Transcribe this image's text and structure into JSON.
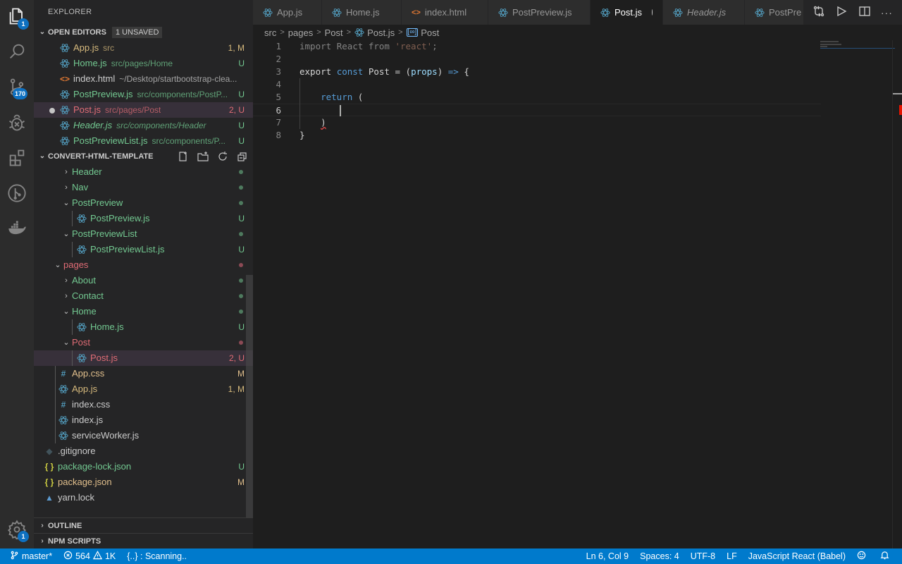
{
  "activity_bar": {
    "explorer_badge": "1",
    "scm_badge": "170",
    "settings_badge": "1"
  },
  "sidebar": {
    "title": "EXPLORER",
    "open_editors": {
      "label": "OPEN EDITORS",
      "badge": "1 UNSAVED",
      "items": [
        {
          "name": "App.js",
          "desc": "src",
          "status": "1, M",
          "color": "yellow",
          "icon": "react-icon"
        },
        {
          "name": "Home.js",
          "desc": "src/pages/Home",
          "status": "U",
          "color": "green",
          "icon": "react-icon"
        },
        {
          "name": "index.html",
          "desc": "~/Desktop/startbootstrap-clea...",
          "status": "",
          "color": "plain",
          "icon": "html-icon"
        },
        {
          "name": "PostPreview.js",
          "desc": "src/components/PostP...",
          "status": "U",
          "color": "green",
          "icon": "react-icon"
        },
        {
          "name": "Post.js",
          "desc": "src/pages/Post",
          "status": "2, U",
          "color": "red",
          "icon": "react-icon",
          "dirty": true
        },
        {
          "name": "Header.js",
          "desc": "src/components/Header",
          "status": "U",
          "color": "green",
          "icon": "react-icon",
          "italic": true
        },
        {
          "name": "PostPreviewList.js",
          "desc": "src/components/P...",
          "status": "U",
          "color": "green",
          "icon": "react-icon"
        }
      ]
    },
    "project": {
      "label": "CONVERT-HTML-TEMPLATE",
      "actions": [
        "new-file",
        "new-folder",
        "refresh",
        "collapse-all"
      ],
      "tree": [
        {
          "name": "Header",
          "type": "folder",
          "expanded": false,
          "depth": 2,
          "color": "green",
          "dot": "#4e7a5e"
        },
        {
          "name": "Nav",
          "type": "folder",
          "expanded": false,
          "depth": 2,
          "color": "green",
          "dot": "#4e7a5e"
        },
        {
          "name": "PostPreview",
          "type": "folder",
          "expanded": true,
          "depth": 2,
          "color": "green",
          "dot": "#4e7a5e"
        },
        {
          "name": "PostPreview.js",
          "type": "file",
          "depth": 3,
          "color": "green",
          "status": "U",
          "icon": "react-icon"
        },
        {
          "name": "PostPreviewList",
          "type": "folder",
          "expanded": true,
          "depth": 2,
          "color": "green",
          "dot": "#4e7a5e"
        },
        {
          "name": "PostPreviewList.js",
          "type": "file",
          "depth": 3,
          "color": "green",
          "status": "U",
          "icon": "react-icon"
        },
        {
          "name": "pages",
          "type": "folder",
          "expanded": true,
          "depth": 1,
          "color": "red",
          "dot": "#8c4a55"
        },
        {
          "name": "About",
          "type": "folder",
          "expanded": false,
          "depth": 2,
          "color": "green",
          "dot": "#4e7a5e"
        },
        {
          "name": "Contact",
          "type": "folder",
          "expanded": false,
          "depth": 2,
          "color": "green",
          "dot": "#4e7a5e"
        },
        {
          "name": "Home",
          "type": "folder",
          "expanded": true,
          "depth": 2,
          "color": "green",
          "dot": "#4e7a5e"
        },
        {
          "name": "Home.js",
          "type": "file",
          "depth": 3,
          "color": "green",
          "status": "U",
          "icon": "react-icon"
        },
        {
          "name": "Post",
          "type": "folder",
          "expanded": true,
          "depth": 2,
          "color": "red",
          "dot": "#8c4a55"
        },
        {
          "name": "Post.js",
          "type": "file",
          "depth": 3,
          "color": "red",
          "status": "2, U",
          "icon": "react-icon",
          "selected": true
        },
        {
          "name": "App.css",
          "type": "file",
          "depth": 1,
          "color": "mod",
          "status": "M",
          "icon": "css-icon"
        },
        {
          "name": "App.js",
          "type": "file",
          "depth": 1,
          "color": "yellow",
          "status": "1, M",
          "icon": "react-icon"
        },
        {
          "name": "index.css",
          "type": "file",
          "depth": 1,
          "color": "plain",
          "status": "",
          "icon": "css-icon"
        },
        {
          "name": "index.js",
          "type": "file",
          "depth": 1,
          "color": "plain",
          "status": "",
          "icon": "react-icon"
        },
        {
          "name": "serviceWorker.js",
          "type": "file",
          "depth": 1,
          "color": "plain",
          "status": "",
          "icon": "react-icon"
        },
        {
          "name": ".gitignore",
          "type": "file",
          "depth": 0,
          "color": "plain",
          "status": "",
          "icon": "git-icon"
        },
        {
          "name": "package-lock.json",
          "type": "file",
          "depth": 0,
          "color": "green",
          "status": "U",
          "icon": "json-icon"
        },
        {
          "name": "package.json",
          "type": "file",
          "depth": 0,
          "color": "mod",
          "status": "M",
          "icon": "json-icon"
        },
        {
          "name": "yarn.lock",
          "type": "file",
          "depth": 0,
          "color": "plain",
          "status": "",
          "icon": "yarn-icon"
        }
      ]
    },
    "outline_label": "OUTLINE",
    "npm_label": "NPM SCRIPTS"
  },
  "tabs": [
    {
      "label": "App.js",
      "icon": "react-icon"
    },
    {
      "label": "Home.js",
      "icon": "react-icon"
    },
    {
      "label": "index.html",
      "icon": "html-icon"
    },
    {
      "label": "PostPreview.js",
      "icon": "react-icon"
    },
    {
      "label": "Post.js",
      "icon": "react-icon",
      "active": true,
      "dirty": true
    },
    {
      "label": "Header.js",
      "icon": "react-icon",
      "italic": true
    },
    {
      "label": "PostPre",
      "icon": "react-icon"
    }
  ],
  "breadcrumb": [
    "src",
    "pages",
    "Post",
    "Post.js",
    "Post"
  ],
  "editor": {
    "lines": [
      {
        "n": "1",
        "tokens": [
          [
            "dim",
            "import "
          ],
          [
            "dim",
            "React "
          ],
          [
            "dim",
            "from "
          ],
          [
            "str",
            "'react'"
          ],
          [
            "dim",
            ";"
          ]
        ]
      },
      {
        "n": "2",
        "tokens": []
      },
      {
        "n": "3",
        "tokens": [
          [
            "id",
            "export "
          ],
          [
            "kw2",
            "const "
          ],
          [
            "id",
            "Post "
          ],
          [
            "op",
            "= "
          ],
          [
            "op",
            "("
          ],
          [
            "param",
            "props"
          ],
          [
            "op",
            ") "
          ],
          [
            "kw2",
            "=> "
          ],
          [
            "op",
            "{"
          ]
        ]
      },
      {
        "n": "4",
        "tokens": []
      },
      {
        "n": "5",
        "tokens": [
          [
            "op",
            "    "
          ],
          [
            "kw2",
            "return "
          ],
          [
            "op",
            "("
          ]
        ]
      },
      {
        "n": "6",
        "tokens": []
      },
      {
        "n": "7",
        "tokens": [
          [
            "op",
            "    "
          ],
          [
            "squig",
            ")"
          ]
        ]
      },
      {
        "n": "8",
        "tokens": [
          [
            "op",
            "}"
          ]
        ]
      }
    ],
    "current_line": "6"
  },
  "statusbar": {
    "branch": "master*",
    "errors": "564",
    "warnings": "1K",
    "scanning": "{..} : Scanning..",
    "position": "Ln 6, Col 9",
    "spaces": "Spaces: 4",
    "encoding": "UTF-8",
    "eol": "LF",
    "language": "JavaScript React (Babel)"
  }
}
